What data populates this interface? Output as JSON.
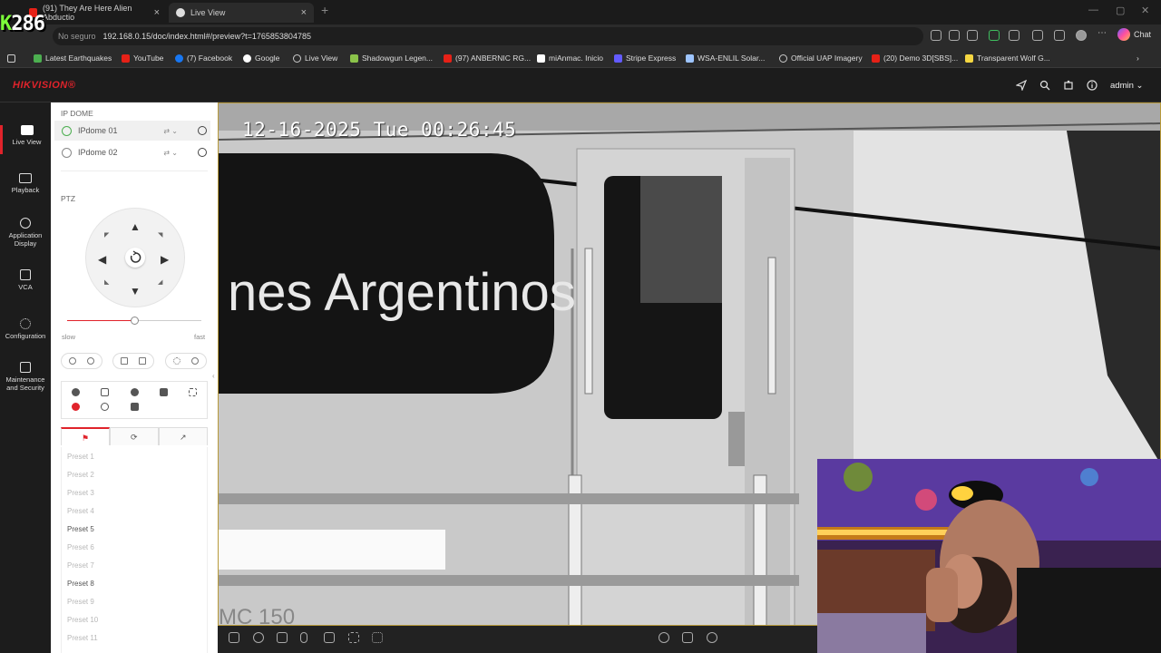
{
  "browser": {
    "tabs": [
      {
        "title": "(91) They Are Here Alien Abductio",
        "active": false
      },
      {
        "title": "Live View",
        "active": true
      }
    ],
    "new_tab": "+",
    "url_security": "No seguro",
    "url": "192.168.0.15/doc/index.html#/preview?t=1765853804785",
    "chat_label": "Chat",
    "overlay_counter": "286",
    "bookmarks": [
      "Latest Earthquakes",
      "YouTube",
      "(7) Facebook",
      "Google",
      "Live View",
      "Shadowgun Legen...",
      "(97) ANBERNIC RG...",
      "miAnmac. Inicio",
      "Stripe Express",
      "WSA-ENLIL Solar...",
      "Official UAP Imagery",
      "(20) Demo 3D[SBS]...",
      "Transparent Wolf G..."
    ]
  },
  "app": {
    "logo": "HIKVISION",
    "user": "admin",
    "nav": [
      {
        "label": "Live View",
        "icon": "live-view-icon"
      },
      {
        "label": "Playback",
        "icon": "playback-icon"
      },
      {
        "label": "Application Display",
        "icon": "application-icon"
      },
      {
        "label": "VCA",
        "icon": "vca-icon"
      },
      {
        "label": "Configuration",
        "icon": "gear-icon"
      },
      {
        "label": "Maintenance and Security",
        "icon": "maintenance-icon"
      }
    ]
  },
  "panel": {
    "group_label": "IP DOME",
    "cameras": [
      {
        "name": "IPdome 01",
        "active": true
      },
      {
        "name": "IPdome 02",
        "active": false
      }
    ],
    "ptz_label": "PTZ",
    "speed_slow": "slow",
    "speed_fast": "fast",
    "speed_level": 0.5,
    "presets": [
      "Preset 1",
      "Preset 2",
      "Preset 3",
      "Preset 4",
      "Preset 5",
      "Preset 6",
      "Preset 7",
      "Preset 8",
      "Preset 9",
      "Preset 10",
      "Preset 11"
    ],
    "presets_enabled": [
      "Preset 5",
      "Preset 8"
    ]
  },
  "video": {
    "osd_datetime": "12-16-2025 Tue 00:26:45",
    "scene_text": "nes Argentinos",
    "scene_plate": "MC 150"
  },
  "colors": {
    "accent": "#e0232b",
    "video_border": "#b89a3a"
  }
}
